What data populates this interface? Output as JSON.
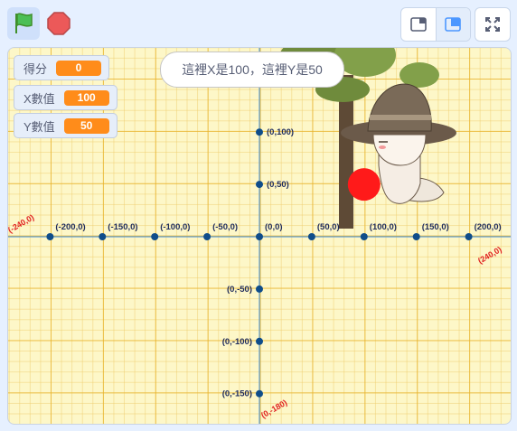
{
  "toolbar": {
    "green_flag_icon": "green-flag-icon",
    "stop_icon": "stop-sign-icon",
    "small_stage_icon": "small-stage-icon",
    "large_stage_icon": "large-stage-icon",
    "fullscreen_icon": "fullscreen-icon"
  },
  "monitors": [
    {
      "label": "得分",
      "value": "0"
    },
    {
      "label": "X數值",
      "value": "100"
    },
    {
      "label": "Y數值",
      "value": "50"
    }
  ],
  "speech_bubble": "這裡X是100，這裡Y是50",
  "x_axis_labels": [
    "(-200,0)",
    "(-150,0)",
    "(-100,0)",
    "(-50,0)",
    "(0,0)",
    "(50,0)",
    "(100,0)",
    "(150,0)",
    "(200,0)"
  ],
  "y_axis_labels": [
    "(0,100)",
    "(0,50)",
    "(0,-50)",
    "(0,-100)",
    "(0,-150)"
  ],
  "edge_labels": {
    "left": "(-240,0)",
    "right": "(240,0)",
    "bottom": "(0,-180)"
  },
  "colors": {
    "grid_background": "#fdf7c8",
    "grid_major": "#e8b228",
    "axis": "#3d8ee0",
    "point": "#0f4d8a",
    "ball": "#ff1a1a",
    "monitor_value": "#ff8c1a",
    "edge_label": "#e02020"
  }
}
